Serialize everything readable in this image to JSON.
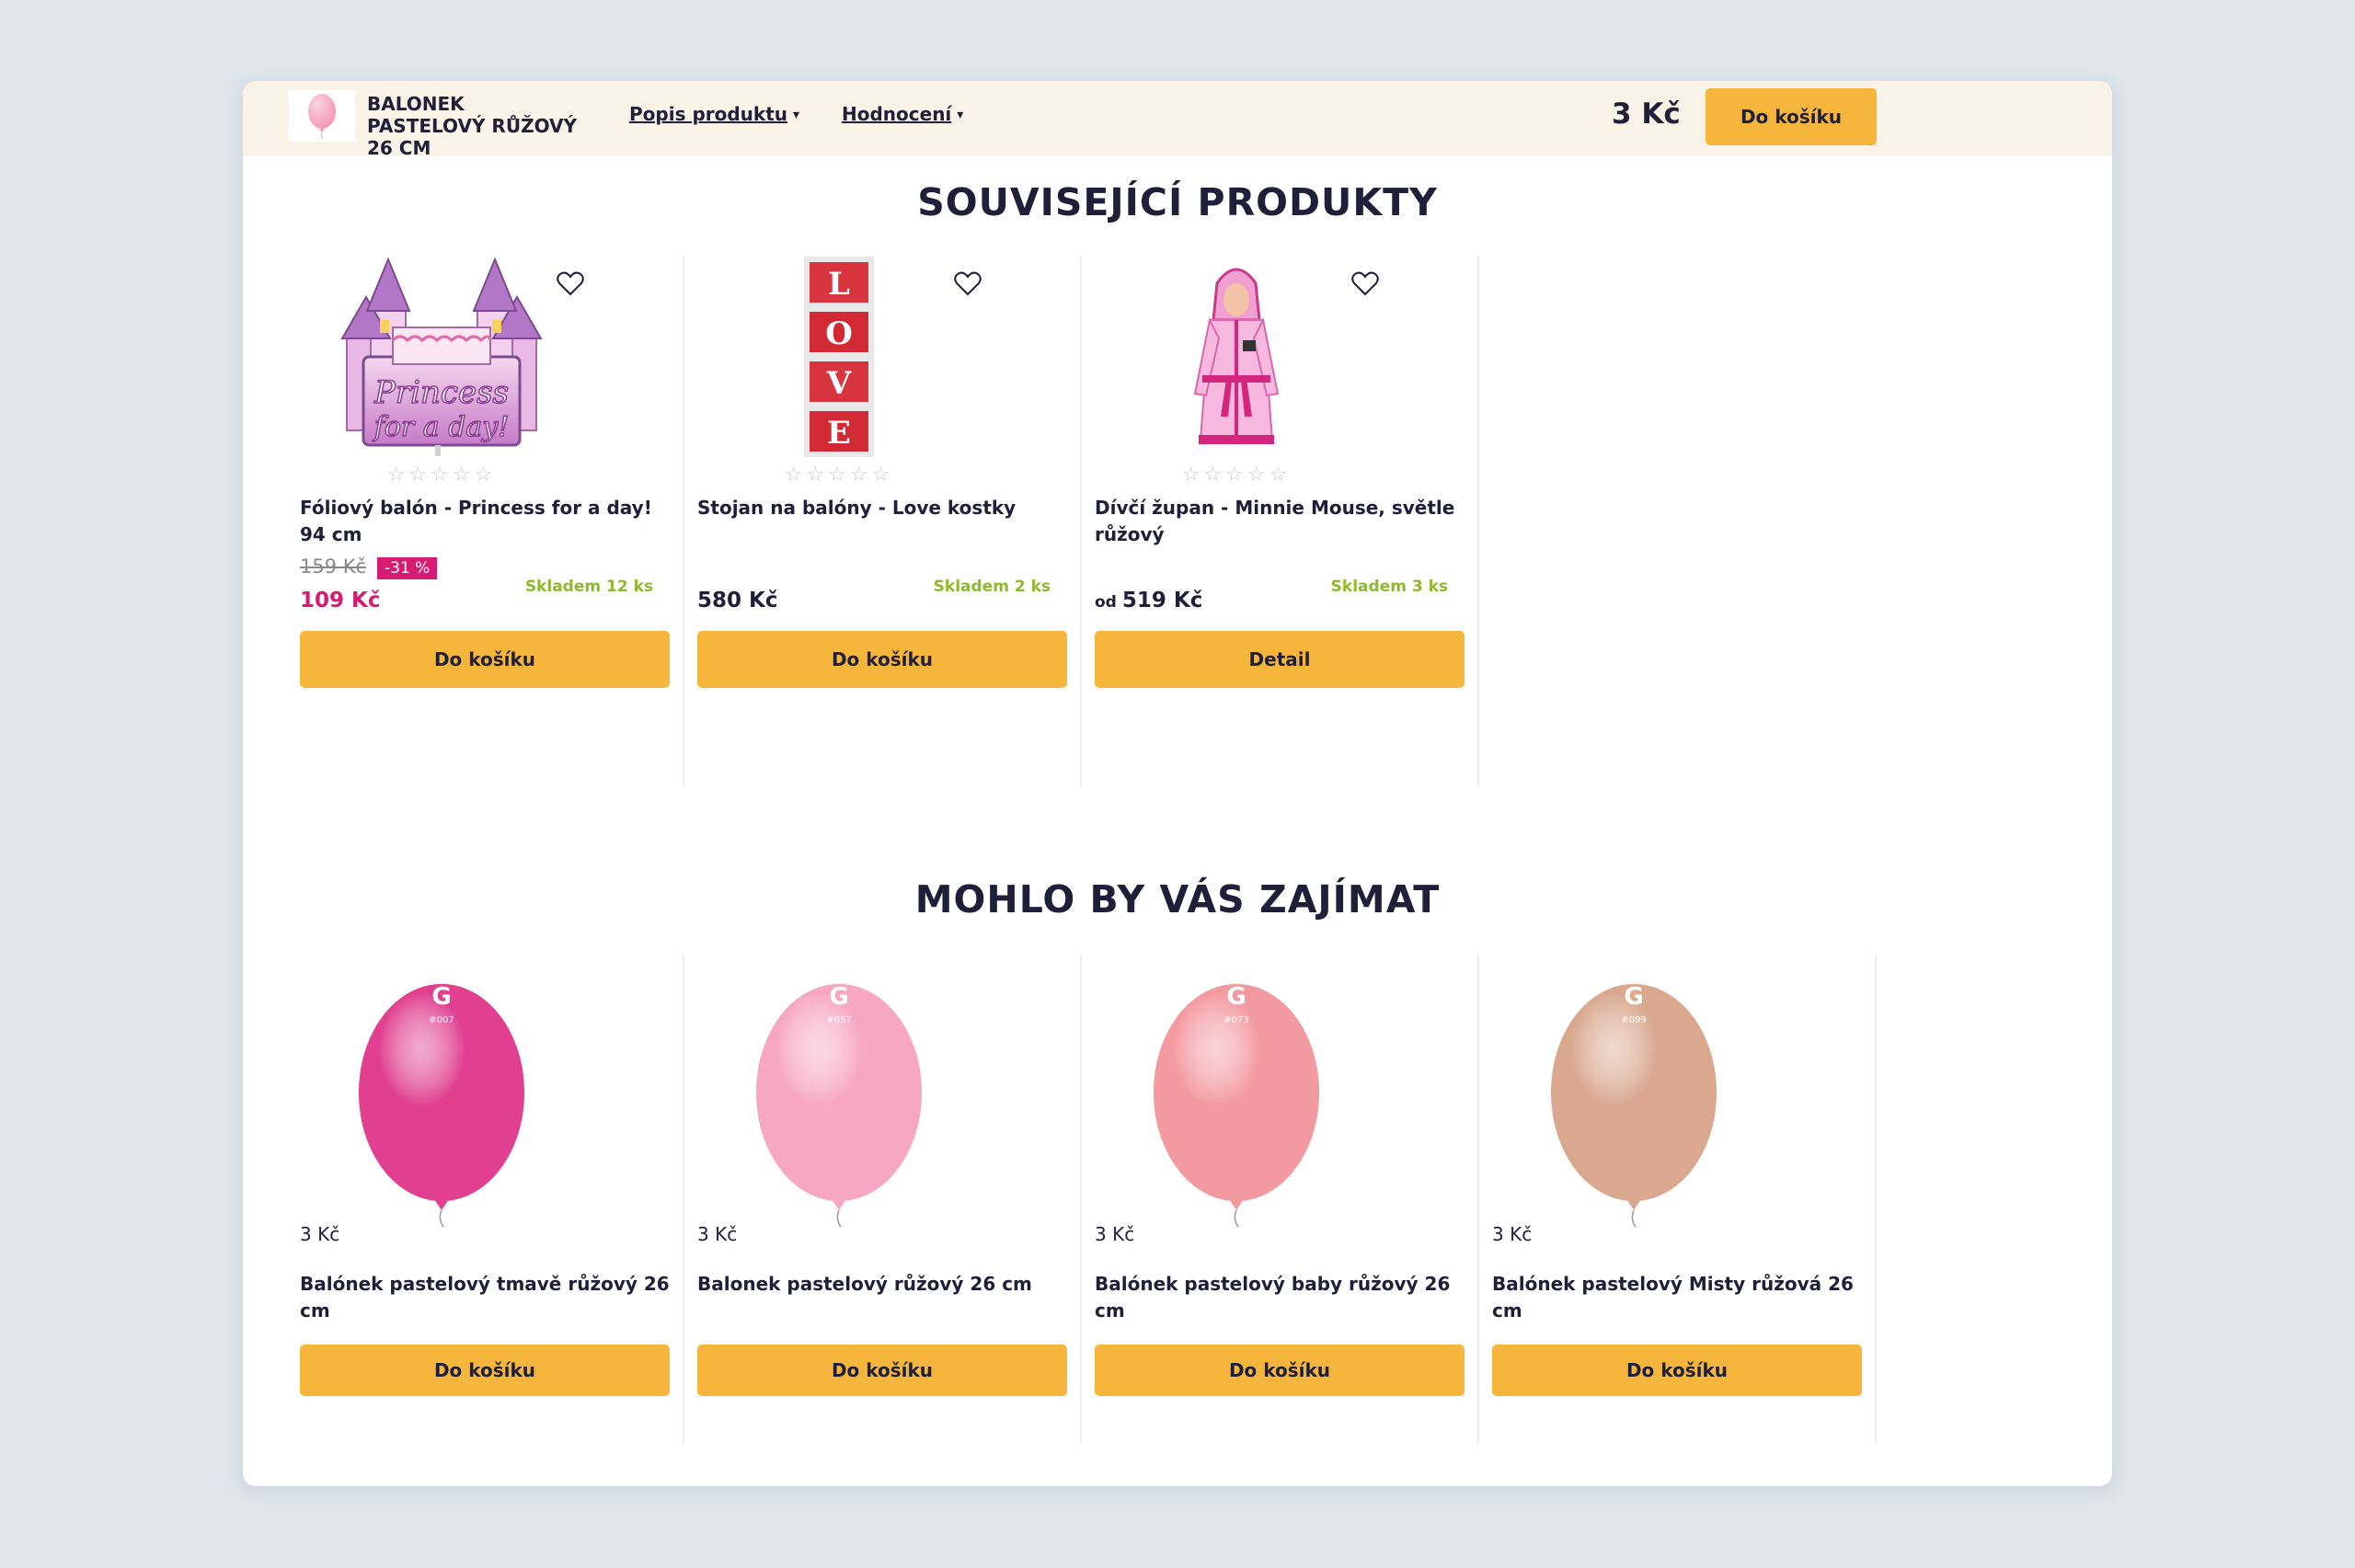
{
  "header": {
    "product_title": "BALONEK PASTELOVÝ RŮŽOVÝ 26 CM",
    "nav": [
      {
        "label": "Popis produktu"
      },
      {
        "label": "Hodnocení"
      }
    ],
    "price": "3 Kč",
    "cart_label": "Do košíku"
  },
  "related": {
    "heading": "SOUVISEJÍCÍ PRODUKTY",
    "items": [
      {
        "name": "Fóliový balón - Princess for a day! 94 cm",
        "old_price": "159 Kč",
        "discount": "-31 %",
        "price": "109 Kč",
        "stock": "Skladem 12 ks",
        "button": "Do košíku",
        "image_text_1": "Princess",
        "image_text_2": "for a day!"
      },
      {
        "name": "Stojan na balóny - Love kostky",
        "price": "580 Kč",
        "stock": "Skladem 2 ks",
        "button": "Do košíku",
        "letters": [
          "L",
          "O",
          "V",
          "E"
        ]
      },
      {
        "name": "Dívčí župan - Minnie Mouse, světle růžový",
        "price_prefix": "od",
        "price": "519 Kč",
        "stock": "Skladem 3 ks",
        "button": "Detail"
      }
    ]
  },
  "suggested": {
    "heading": "MOHLO BY VÁS ZAJÍMAT",
    "items": [
      {
        "price": "3 Kč",
        "name": "Balónek pastelový tmavě růžový 26 cm",
        "button": "Do košíku",
        "color": "#e0408f",
        "code": "#007"
      },
      {
        "price": "3 Kč",
        "name": "Balonek pastelový růžový 26 cm",
        "button": "Do košíku",
        "color": "#f7a7c1",
        "code": "#057"
      },
      {
        "price": "3 Kč",
        "name": "Balónek pastelový baby růžový 26 cm",
        "button": "Do košíku",
        "color": "#f39aa0",
        "code": "#073"
      },
      {
        "price": "3 Kč",
        "name": "Balónek pastelový Misty růžová 26 cm",
        "button": "Do košíku",
        "color": "#d9a88f",
        "code": "#099"
      }
    ]
  },
  "colors": {
    "accent": "#f5b63b",
    "sale": "#d81b72",
    "stock": "#8dba2c",
    "header_bg": "#f8f3e6"
  }
}
